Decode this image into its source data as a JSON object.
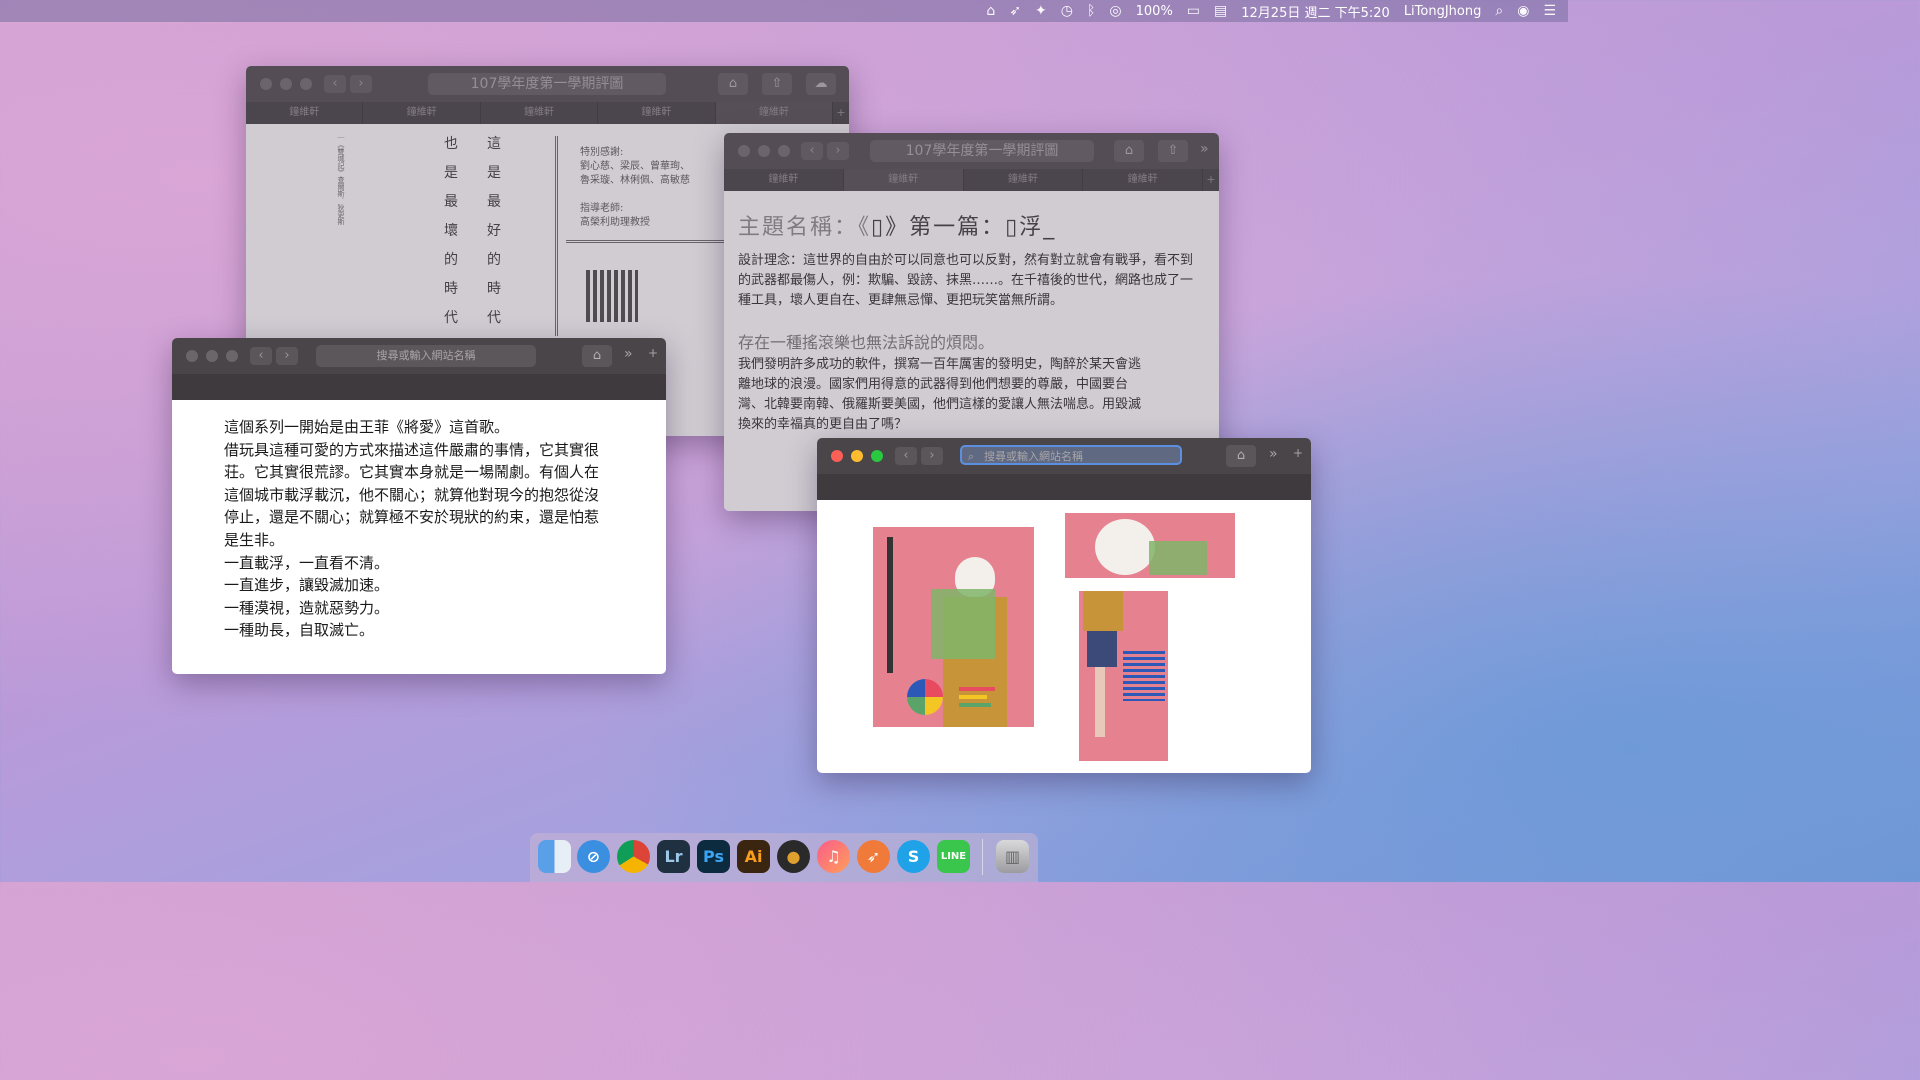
{
  "menubar": {
    "battery": "100%",
    "datetime": "12月25日 週二 下午5:20",
    "user": "LiTongJhong"
  },
  "window1": {
    "url_text": "107學年度第一學期評圖",
    "tabs": [
      "鐘維軒",
      "鐘維軒",
      "鐘維軒",
      "鐘維軒",
      "鐘維軒"
    ],
    "small_vertical": "｜《雙城記》查爾斯．狄更斯",
    "column_left": [
      "也",
      "是",
      "最",
      "壞",
      "的",
      "時",
      "代"
    ],
    "column_right": [
      "這",
      "是",
      "最",
      "好",
      "的",
      "時",
      "代"
    ],
    "thanks_label": "特別感謝:",
    "thanks_names_1": "劉心慈、梁辰、曾華珣、",
    "thanks_names_2": "魯采璇、林俐佩、高敏慈",
    "advisor_label": "指導老師:",
    "advisor_name": "高榮利助理教授"
  },
  "window2": {
    "url_text": "107學年度第一學期評圖",
    "tabs": [
      "鐘維軒",
      "鐘維軒",
      "鐘維軒",
      "鐘維軒"
    ],
    "title_gray": "主題名稱：《",
    "title_mid": "》第一篇：",
    "title_end": "浮_",
    "concept": "設計理念：這世界的自由於可以同意也可以反對，然有對立就會有戰爭，看不到的武器都最傷人，例：欺騙、毀謗、抹黑……。在千禧後的世代，網路也成了一種工具，壞人更自在、更肆無忌憚、更把玩笑當無所謂。",
    "subtitle": "存在一種搖滾樂也無法訴說的煩悶。",
    "body": "我們發明許多成功的軟件，撰寫一百年厲害的發明史，陶醉於某天會逃離地球的浪漫。國家們用得意的武器得到他們想要的尊嚴，中國要台灣、北韓要南韓、俄羅斯要美國，他們這樣的愛讓人無法喘息。用毀滅換來的幸福真的更自由了嗎？"
  },
  "window3": {
    "search_placeholder": "搜尋或輸入網站名稱",
    "lines": [
      "這個系列一開始是由王菲《將愛》這首歌。",
      "借玩具這種可愛的方式來描述這件嚴肅的事情，它其實很",
      "荘。它其實很荒謬。它其實本身就是一場鬧劇。有個人在",
      "這個城市載浮載沉，他不關心；就算他對現今的抱怨從沒",
      "停止，還是不關心；就算極不安於現狀的約束，還是怕惹",
      "是生非。",
      "一直載浮，一直看不清。",
      "一直進步，讓毀滅加速。",
      "一種漠視，造就惡勢力。",
      "一種助長，自取滅亡。"
    ]
  },
  "window4": {
    "search_placeholder": "搜尋或輸入網站名稱"
  },
  "colors": {
    "pink": "#e6818f",
    "green_overlay": "#7fb56a",
    "blue_bars": "#2c58b8"
  },
  "dock": [
    "finder",
    "safari",
    "chrome",
    "Lr",
    "Ps",
    "Ai",
    "obs",
    "itunes",
    "rocket",
    "S",
    "LINE",
    "trash"
  ]
}
